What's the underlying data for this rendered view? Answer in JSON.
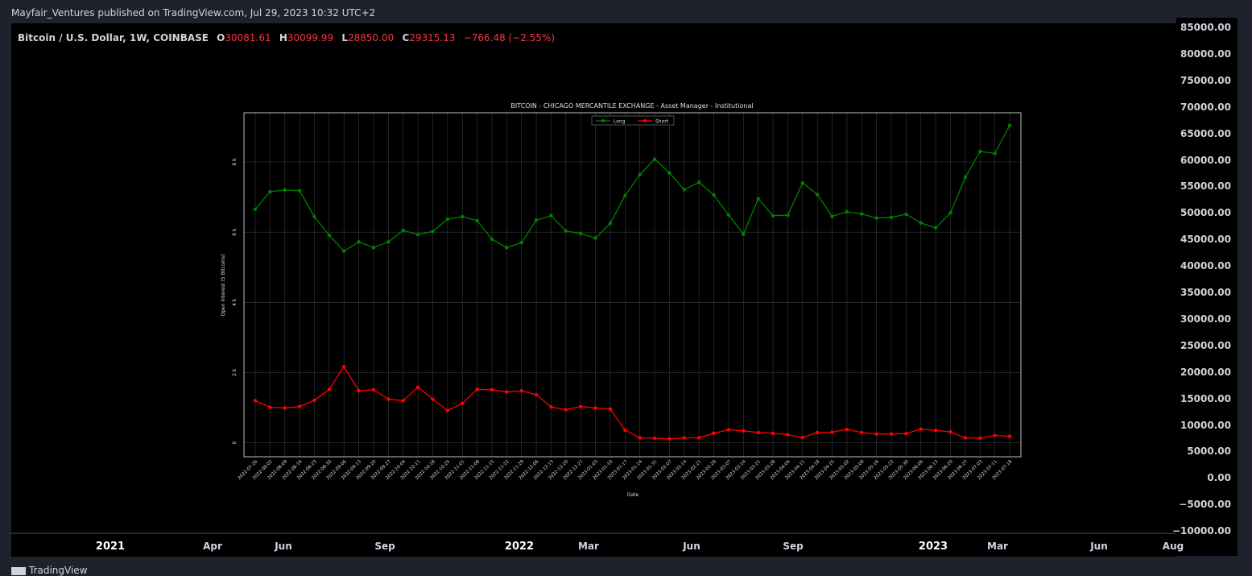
{
  "publication": "Mayfair_Ventures published on TradingView.com, Jul 29, 2023 10:32 UTC+2",
  "symbol": {
    "name": "Bitcoin / U.S. Dollar, 1W, COINBASE",
    "open_label": "O",
    "open": "30081.61",
    "high_label": "H",
    "high": "30099.99",
    "low_label": "L",
    "low": "28850.00",
    "close_label": "C",
    "close": "29315.13",
    "change": "−766.48 (−2.55%)"
  },
  "price_axis": {
    "ticks": [
      "85000.00",
      "80000.00",
      "75000.00",
      "70000.00",
      "65000.00",
      "60000.00",
      "55000.00",
      "50000.00",
      "45000.00",
      "40000.00",
      "35000.00",
      "30000.00",
      "25000.00",
      "20000.00",
      "15000.00",
      "10000.00",
      "5000.00",
      "0.00",
      "−5000.00",
      "−10000.00"
    ]
  },
  "time_axis": {
    "labels": [
      {
        "text": "2021",
        "year": true
      },
      {
        "text": "Apr",
        "year": false
      },
      {
        "text": "Jun",
        "year": false
      },
      {
        "text": "Sep",
        "year": false
      },
      {
        "text": "2022",
        "year": true
      },
      {
        "text": "Mar",
        "year": false
      },
      {
        "text": "Jun",
        "year": false
      },
      {
        "text": "Sep",
        "year": false
      },
      {
        "text": "2023",
        "year": true
      },
      {
        "text": "Mar",
        "year": false
      },
      {
        "text": "Jun",
        "year": false
      },
      {
        "text": "Aug",
        "year": false
      }
    ]
  },
  "logo_text": "TradingView",
  "colors": {
    "long": "#008000",
    "short": "#ff0000",
    "down": "#f23645",
    "grid": "#3a3a3a",
    "frame": "#bbbbbb"
  },
  "chart_data": {
    "type": "line",
    "title": "BITCOIN - CHICAGO MERCANTILE EXCHANGE - Asset Manager - Institutional",
    "xlabel": "Date",
    "ylabel": "Open interest (5 Bitcoins)",
    "ylim": [
      -400,
      9400
    ],
    "yticks": [
      0,
      2000,
      4000,
      6000,
      8000
    ],
    "ytick_labels": [
      "0",
      "2 k",
      "4 k",
      "6 k",
      "8 k"
    ],
    "grid": true,
    "legend": "top-center",
    "x": [
      "2022-07-26",
      "2022-08-02",
      "2022-08-09",
      "2022-08-16",
      "2022-08-23",
      "2022-08-30",
      "2022-09-06",
      "2022-09-13",
      "2022-09-20",
      "2022-09-27",
      "2022-10-04",
      "2022-10-11",
      "2022-10-18",
      "2022-10-25",
      "2022-11-01",
      "2022-11-08",
      "2022-11-15",
      "2022-11-22",
      "2022-11-29",
      "2022-12-06",
      "2022-12-13",
      "2022-12-20",
      "2022-12-27",
      "2023-01-03",
      "2023-01-10",
      "2023-01-17",
      "2023-01-24",
      "2023-01-31",
      "2023-02-07",
      "2023-02-14",
      "2023-02-21",
      "2023-02-28",
      "2023-03-07",
      "2023-03-14",
      "2023-03-21",
      "2023-03-28",
      "2023-04-04",
      "2023-04-11",
      "2023-04-18",
      "2023-04-25",
      "2023-05-02",
      "2023-05-09",
      "2023-05-16",
      "2023-05-23",
      "2023-05-30",
      "2023-06-06",
      "2023-06-13",
      "2023-06-20",
      "2023-06-27",
      "2023-07-03",
      "2023-07-11",
      "2023-07-18"
    ],
    "series": [
      {
        "name": "Long",
        "values": [
          6650,
          7150,
          7200,
          7180,
          6440,
          5910,
          5460,
          5720,
          5560,
          5720,
          6050,
          5930,
          6020,
          6370,
          6440,
          6330,
          5800,
          5560,
          5700,
          6340,
          6470,
          6030,
          5960,
          5830,
          6250,
          7040,
          7640,
          8080,
          7690,
          7210,
          7420,
          7060,
          6490,
          5940,
          6950,
          6470,
          6480,
          7400,
          7070,
          6450,
          6580,
          6520,
          6400,
          6420,
          6510,
          6260,
          6120,
          6550,
          7560,
          8300,
          8240,
          9040
        ]
      },
      {
        "name": "Short",
        "values": [
          1200,
          1010,
          990,
          1030,
          1210,
          1520,
          2170,
          1480,
          1510,
          1240,
          1200,
          1580,
          1240,
          920,
          1120,
          1520,
          1510,
          1450,
          1480,
          1370,
          1020,
          940,
          1030,
          990,
          960,
          360,
          140,
          130,
          110,
          140,
          140,
          270,
          370,
          340,
          290,
          270,
          230,
          150,
          290,
          300,
          380,
          290,
          250,
          250,
          260,
          390,
          350,
          310,
          140,
          130,
          210,
          180
        ]
      }
    ]
  }
}
